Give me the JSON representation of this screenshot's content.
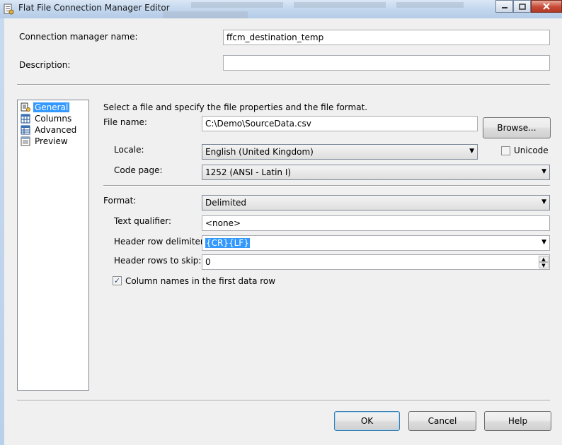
{
  "window": {
    "title": "Flat File Connection Manager Editor"
  },
  "header": {
    "cm_name_label": "Connection manager name:",
    "cm_name_value": "ffcm_destination_temp",
    "description_label": "Description:",
    "description_value": ""
  },
  "nav": {
    "items": [
      {
        "label": "General",
        "icon": "general-icon",
        "selected": true
      },
      {
        "label": "Columns",
        "icon": "columns-icon",
        "selected": false
      },
      {
        "label": "Advanced",
        "icon": "advanced-icon",
        "selected": false
      },
      {
        "label": "Preview",
        "icon": "preview-icon",
        "selected": false
      }
    ]
  },
  "general": {
    "intro": "Select a file and specify the file properties and the file format.",
    "file_name_label": "File name:",
    "file_name_value": "C:\\Demo\\SourceData.csv",
    "browse_label": "Browse...",
    "locale_label": "Locale:",
    "locale_value": "English (United Kingdom)",
    "unicode_label": "Unicode",
    "unicode_checked": false,
    "code_page_label": "Code page:",
    "code_page_value": "1252  (ANSI - Latin I)",
    "format_label": "Format:",
    "format_value": "Delimited",
    "text_qualifier_label": "Text qualifier:",
    "text_qualifier_value": "<none>",
    "header_delim_label": "Header row delimiter:",
    "header_delim_value": "{CR}{LF}",
    "header_skip_label": "Header rows to skip:",
    "header_skip_value": "0",
    "col_names_label": "Column names in the first data row",
    "col_names_checked": true
  },
  "footer": {
    "ok_label": "OK",
    "cancel_label": "Cancel",
    "help_label": "Help"
  }
}
